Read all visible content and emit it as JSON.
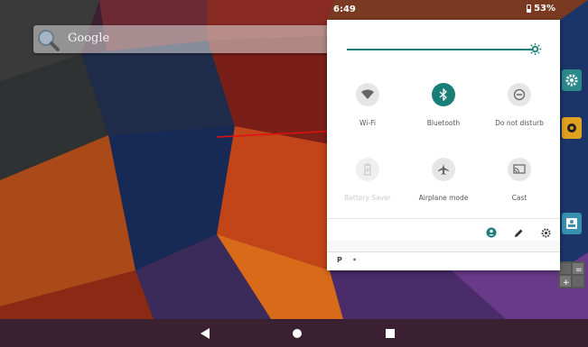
{
  "status_bar": {
    "time": "6:49",
    "battery": "53%"
  },
  "search": {
    "placeholder": "Google"
  },
  "quick_settings": {
    "accent_color": "#1a7e78",
    "brightness_level": 1.0,
    "tiles": [
      {
        "id": "wifi",
        "label": "Wi-Fi",
        "icon": "wifi-icon",
        "state": "off"
      },
      {
        "id": "bluetooth",
        "label": "Bluetooth",
        "icon": "bluetooth-icon",
        "state": "on"
      },
      {
        "id": "dnd",
        "label": "Do not disturb",
        "icon": "do-not-disturb-icon",
        "state": "off"
      },
      {
        "id": "battery-saver",
        "label": "Battery Saver",
        "icon": "battery-saver-icon",
        "state": "disabled"
      },
      {
        "id": "airplane",
        "label": "Airplane mode",
        "icon": "airplane-icon",
        "state": "off"
      },
      {
        "id": "cast",
        "label": "Cast",
        "icon": "cast-icon",
        "state": "off"
      }
    ],
    "footer_icons": [
      "user-icon",
      "edit-icon",
      "settings-icon"
    ]
  },
  "notification": {
    "app_letter": "P",
    "separator": "•"
  },
  "side_apps": [
    "settings-app-icon",
    "camera-app-icon",
    "contacts-app-icon",
    "calculator-app-icon"
  ],
  "nav": [
    "back-icon",
    "home-icon",
    "recents-icon"
  ]
}
